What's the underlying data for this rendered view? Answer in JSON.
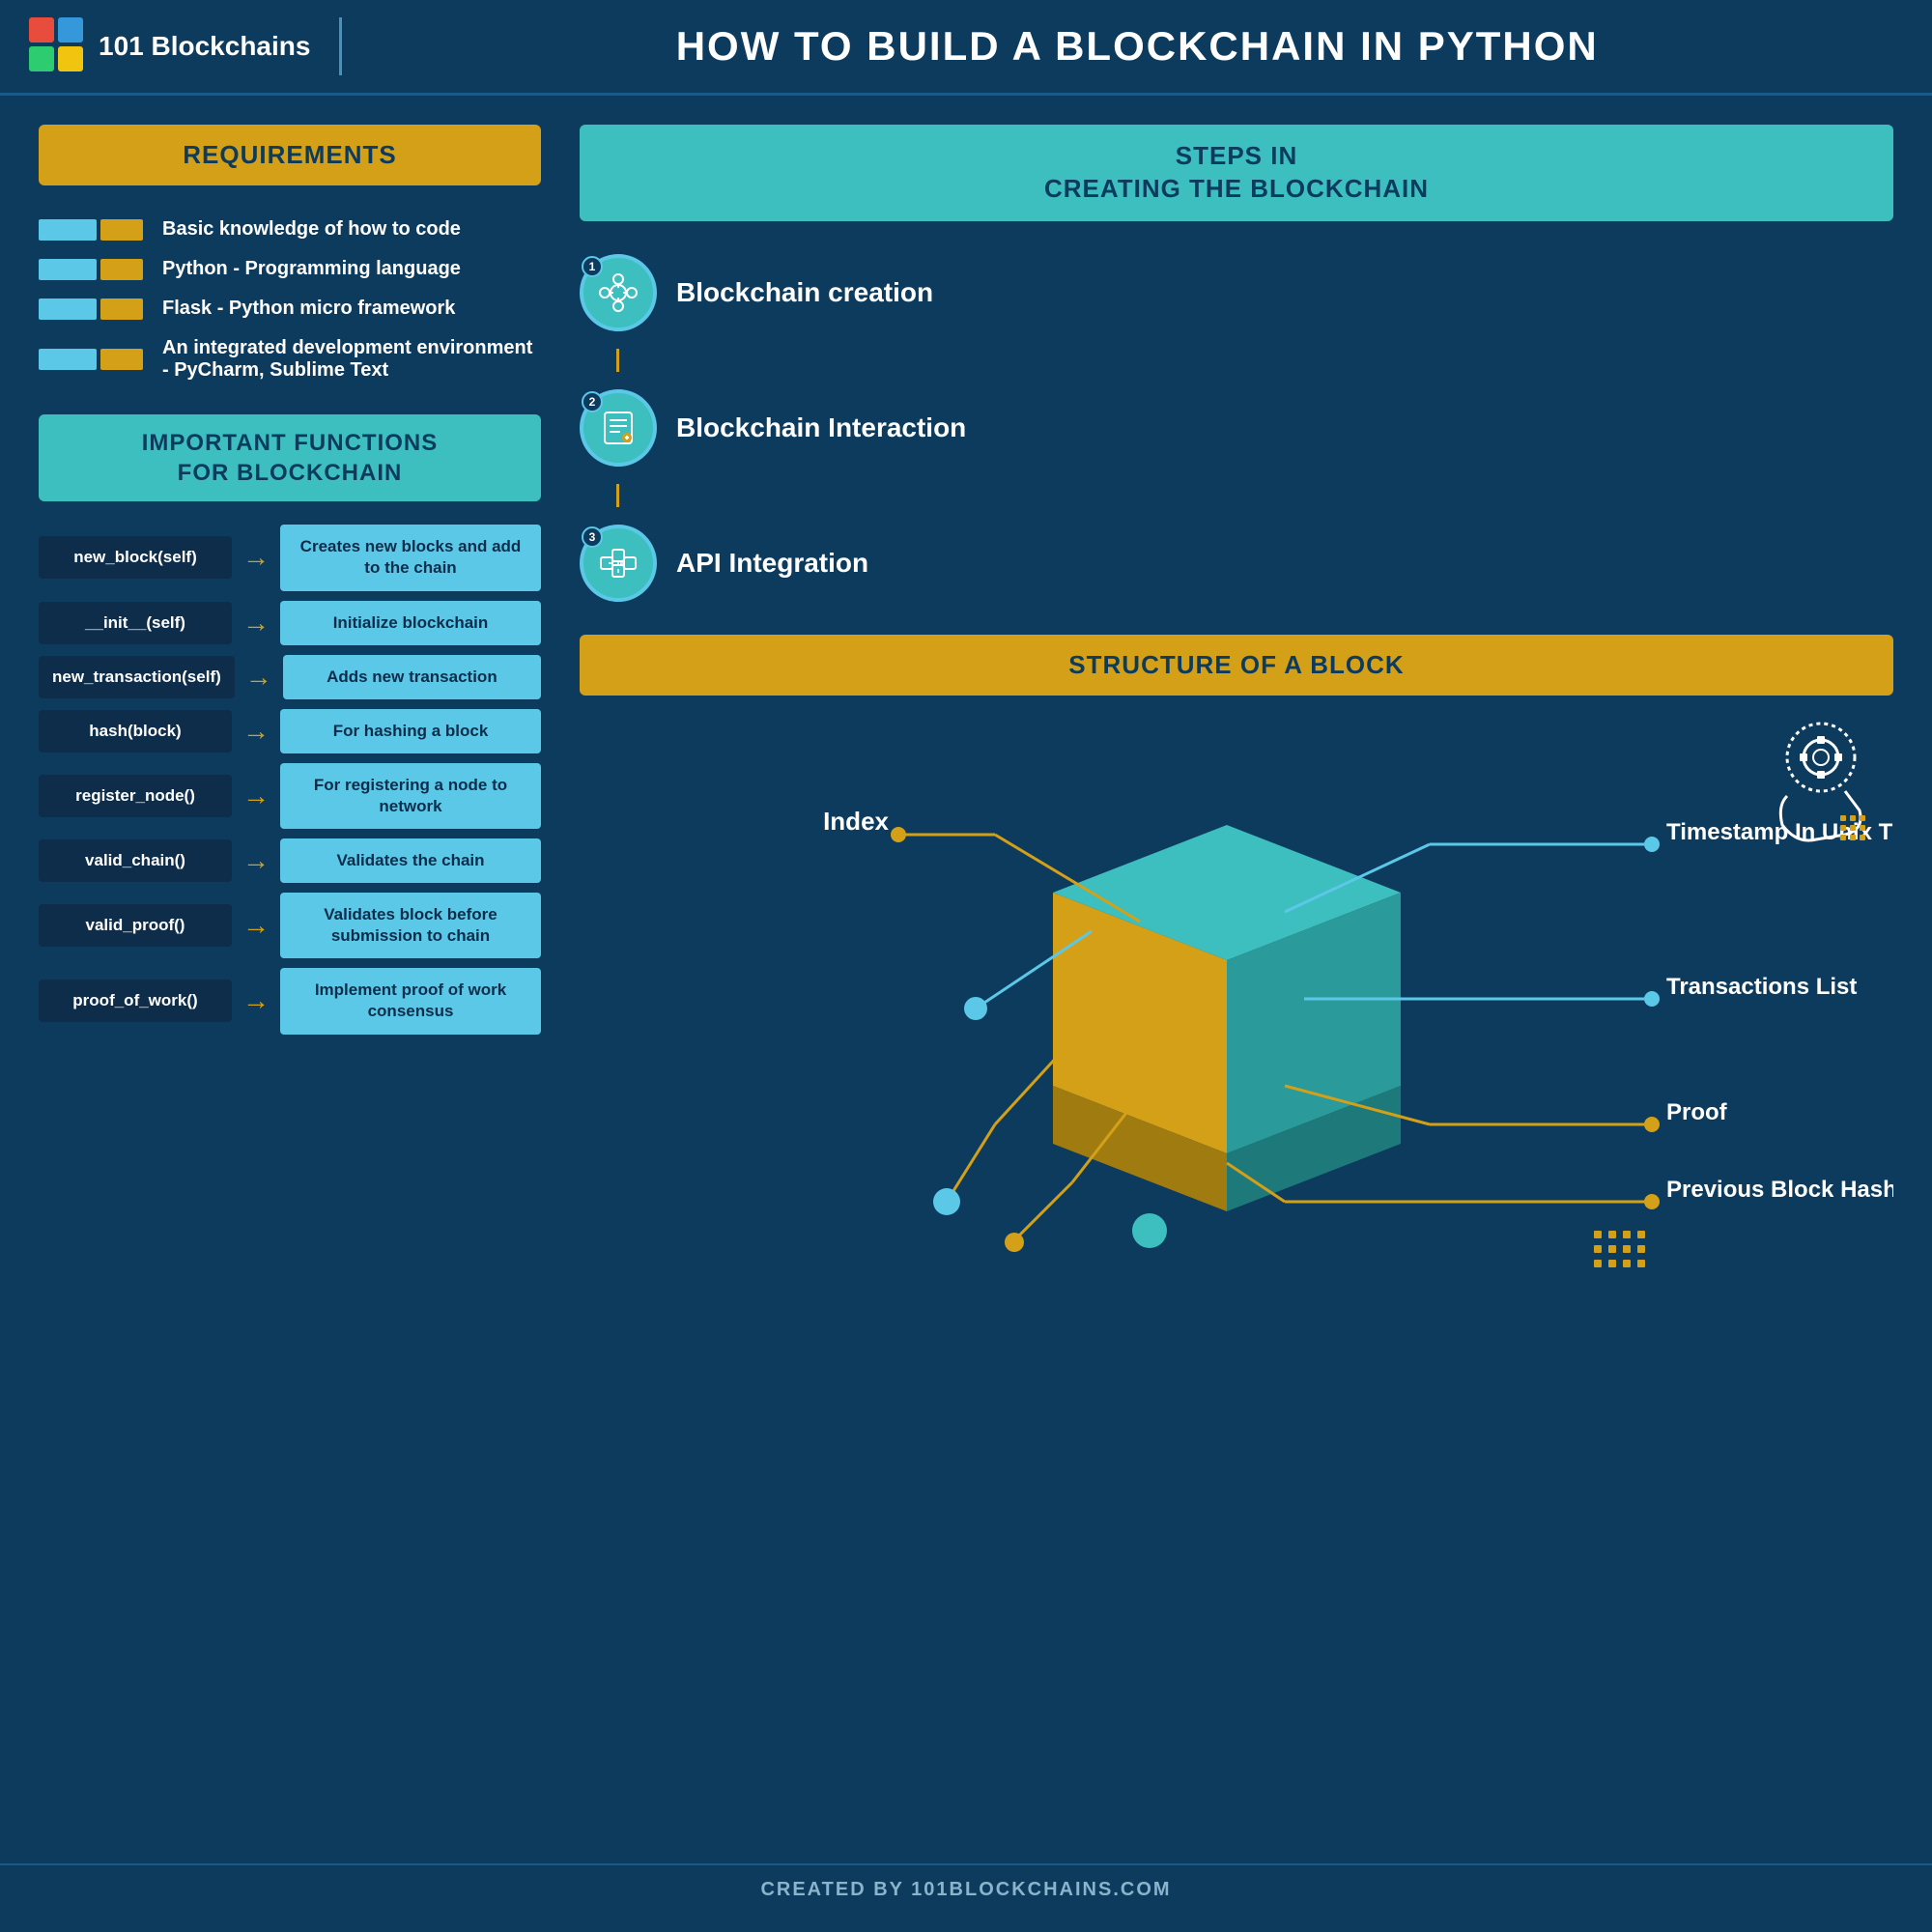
{
  "header": {
    "logo_text": "101 Blockchains",
    "title": "HOW TO BUILD A BLOCKCHAIN IN PYTHON"
  },
  "requirements": {
    "section_title": "REQUIREMENTS",
    "items": [
      "Basic knowledge of how to code",
      "Python - Programming language",
      "Flask - Python micro framework",
      "An integrated development environment - PyCharm, Sublime Text"
    ]
  },
  "functions": {
    "section_title": "IMPORTANT FUNCTIONS\nFOR BLOCKCHAIN",
    "items": [
      {
        "name": "new_block(self)",
        "desc": "Creates new blocks and add to the chain"
      },
      {
        "name": "__init__(self)",
        "desc": "Initialize blockchain"
      },
      {
        "name": "new_transaction(self)",
        "desc": "Adds new transaction"
      },
      {
        "name": "hash(block)",
        "desc": "For hashing a block"
      },
      {
        "name": "register_node()",
        "desc": "For registering a node to network"
      },
      {
        "name": "valid_chain()",
        "desc": "Validates the chain"
      },
      {
        "name": "valid_proof()",
        "desc": "Validates block before submission to chain"
      },
      {
        "name": "proof_of_work()",
        "desc": "Implement proof of work consensus"
      }
    ]
  },
  "steps": {
    "section_title": "STEPS IN\nCREATING THE BLOCKCHAIN",
    "items": [
      {
        "number": "1",
        "label": "Blockchain creation"
      },
      {
        "number": "2",
        "label": "Blockchain Interaction"
      },
      {
        "number": "3",
        "label": "API Integration"
      }
    ]
  },
  "block_structure": {
    "section_title": "STRUCTURE OF A BLOCK",
    "fields": [
      "Index",
      "Timestamp In Unix Time",
      "Transactions List",
      "Proof",
      "Previous Block Hash"
    ]
  },
  "footer": {
    "text": "CREATED BY 101BLOCKCHAINS.COM"
  }
}
